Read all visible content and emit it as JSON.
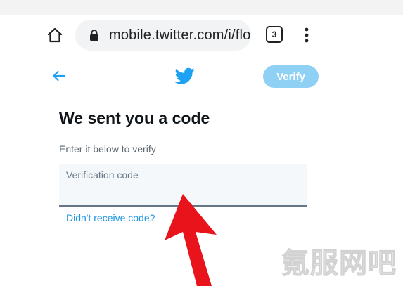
{
  "browser": {
    "url": "mobile.twitter.com/i/flo",
    "tab_count": "3"
  },
  "header": {
    "verify_label": "Verify"
  },
  "main": {
    "title": "We sent you a code",
    "subtitle": "Enter it below to verify",
    "code_placeholder": "Verification code",
    "resend_link": "Didn't receive code?"
  },
  "icons": {
    "home": "home-icon",
    "lock": "lock-icon",
    "tabs": "tab-switcher-icon",
    "menu": "more-vert-icon",
    "back": "arrow-left-icon",
    "logo": "twitter-bird-icon",
    "annotation": "red-arrow-icon"
  },
  "colors": {
    "accent": "#1da1f2",
    "verify_disabled": "#8fd0f5",
    "link": "#1b95e0",
    "arrow": "#e8131b"
  },
  "watermark": {
    "text": "氪服网吧"
  }
}
